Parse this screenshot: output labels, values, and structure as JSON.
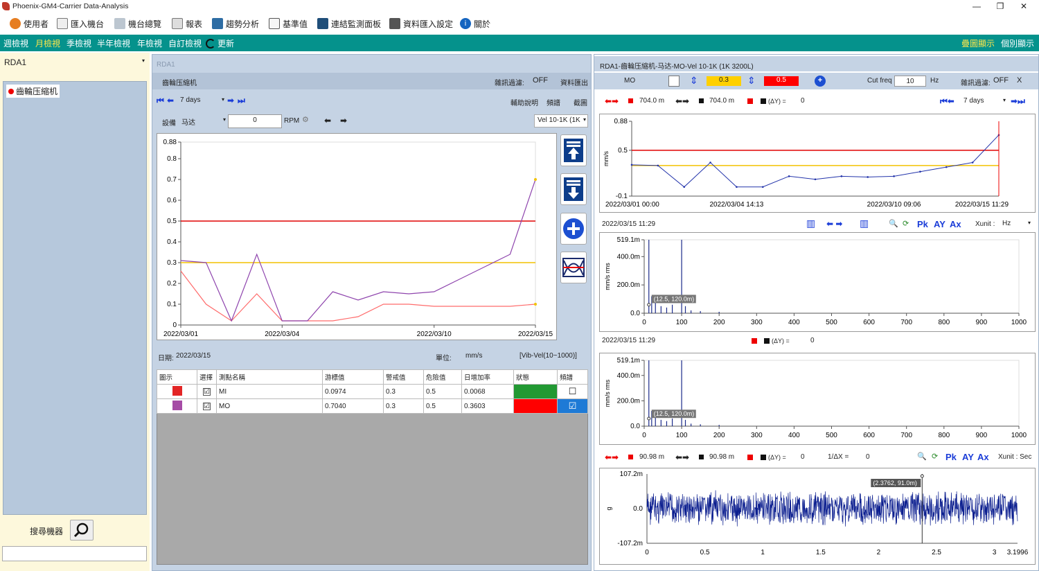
{
  "window": {
    "title": "Phoenix-GM4-Carrier Data-Analysis",
    "controls": [
      "—",
      "❐",
      "✕"
    ]
  },
  "menu": [
    {
      "label": "使用者",
      "color": "#e67e22"
    },
    {
      "label": "匯入機台",
      "color": "#7f8c8d"
    },
    {
      "label": "機台總覽",
      "color": "#2c3e50"
    },
    {
      "label": "報表",
      "color": "#95a5a6"
    },
    {
      "label": "趨勢分析",
      "color": "#2e6da4"
    },
    {
      "label": "基準值",
      "color": "#34495e"
    },
    {
      "label": "連結監測面板",
      "color": "#1f4e79"
    },
    {
      "label": "資料匯入設定",
      "color": "#555555"
    },
    {
      "label": "關於",
      "color": "#1565c0"
    }
  ],
  "views": {
    "items": [
      "週檢視",
      "月檢視",
      "季檢視",
      "半年檢視",
      "年檢視",
      "自訂檢視"
    ],
    "active": 1,
    "refresh": "更新",
    "overlay": "疊圖顯示",
    "individual": "個別顯示"
  },
  "left": {
    "selected": "RDA1",
    "tree_item": "齒輪压縮机",
    "search_label": "搜尋機器",
    "search_value": ""
  },
  "mid": {
    "title": "RDA1",
    "machine": "齒輪压縮机",
    "noise_filter_label": "雜訊過濾:",
    "noise_filter_value": "OFF",
    "export": "資料匯出",
    "period": "7 days",
    "help": "輔助說明",
    "spectrum": "頻譜",
    "screenshot": "截圖",
    "device_label": "設備",
    "device_value": "马达",
    "rpm_value": "0",
    "rpm_label": "RPM",
    "measure": "Vel 10-1K (1K",
    "date_label": "日期:",
    "date_value": "2022/03/15",
    "unit_label": "單位:",
    "unit_value": "mm/s",
    "range": "[Vib-Vel(10~1000)]",
    "table": {
      "headers": [
        "圖示",
        "選擇",
        "測點名稱",
        "游標值",
        "警戒值",
        "危險值",
        "日增加率",
        "狀態",
        "頻譜"
      ],
      "rows": [
        {
          "color": "#e32525",
          "checked": "☑",
          "name": "MI",
          "cursor": "0.0974",
          "warn": "0.3",
          "danger": "0.5",
          "rate": "0.0068",
          "status": "#229933",
          "spec": "☐"
        },
        {
          "color": "#a64ca6",
          "checked": "☑",
          "name": "MO",
          "cursor": "0.7040",
          "warn": "0.3",
          "danger": "0.5",
          "rate": "0.3603",
          "status": "#ff0000",
          "spec": "☑"
        }
      ]
    }
  },
  "right": {
    "title": "RDA1-齒輪压縮机-马达-MO-Vel 10-1K (1K 3200L)",
    "point": "MO",
    "warn": "0.3",
    "danger": "0.5",
    "cutfreq_label": "Cut freq",
    "cutfreq_value": "10",
    "hz": "Hz",
    "noise_label": "雜訊過濾:",
    "noise_value": "OFF",
    "close": "X",
    "cursor1": "704.0 m",
    "cursor2": "704.0 m",
    "delta_label": "(ΔY) =",
    "delta_value": "0",
    "period": "7 days",
    "spec_time1": "2022/03/15 11:29",
    "xunit_label": "Xunit :",
    "xunit_value": "Hz",
    "spec_time2": "2022/03/15 11:29",
    "delta2_value": "0",
    "wave_c1": "90.98 m",
    "wave_c2": "90.98 m",
    "delta3_value": "0",
    "inv_label": "1/ΔX =",
    "inv_value": "0",
    "xunit2": "Xunit : Sec",
    "tool_labels": [
      "Pk",
      "AY",
      "Ax"
    ],
    "spec_tooltip": "(12.5, 120.0m)",
    "wave_tooltip": "(2.3762, 91.0m)"
  },
  "chart_data": [
    {
      "type": "line",
      "title": "",
      "xlabel": "",
      "ylabel": "",
      "ylim": [
        0,
        0.88
      ],
      "yticks": [
        "0.88",
        "0.8",
        "0.7",
        "0.6",
        "0.5",
        "0.4",
        "0.3",
        "0.2",
        "0.1",
        "0"
      ],
      "xticklabels": [
        "2022/03/01",
        "2022/03/04",
        "2022/03/10",
        "2022/03/15"
      ],
      "x": [
        0,
        1,
        2,
        3,
        4,
        5,
        6,
        7,
        8,
        9,
        10,
        11,
        12,
        13,
        14
      ],
      "series": [
        {
          "name": "MI",
          "color": "#ff6b6b",
          "values": [
            0.26,
            0.1,
            0.02,
            0.15,
            0.02,
            0.02,
            0.02,
            0.04,
            0.1,
            0.1,
            0.09,
            0.09,
            0.09,
            0.09,
            0.1
          ]
        },
        {
          "name": "MO",
          "color": "#8e44ad",
          "values": [
            0.31,
            0.3,
            0.02,
            0.34,
            0.02,
            0.02,
            0.16,
            0.12,
            0.16,
            0.15,
            0.16,
            0.22,
            0.28,
            0.34,
            0.7
          ]
        }
      ],
      "thresholds": [
        {
          "value": 0.5,
          "color": "#e00000"
        },
        {
          "value": 0.3,
          "color": "#f2c200"
        }
      ]
    },
    {
      "type": "line",
      "title": "",
      "ylabel": "mm/s",
      "ylim": [
        -0.1,
        0.88
      ],
      "yticks": [
        "0.88",
        "0.5",
        "-0.1"
      ],
      "xticklabels": [
        "2022/03/01 00:00",
        "2022/03/04 14:13",
        "2022/03/10 09:06",
        "2022/03/15 11:29"
      ],
      "series": [
        {
          "name": "MO",
          "color": "#2233aa",
          "values": [
            0.31,
            0.3,
            0.02,
            0.34,
            0.02,
            0.02,
            0.16,
            0.12,
            0.16,
            0.15,
            0.16,
            0.22,
            0.28,
            0.34,
            0.7
          ]
        }
      ],
      "thresholds": [
        {
          "value": 0.5,
          "color": "#e00000"
        },
        {
          "value": 0.3,
          "color": "#f2c200"
        }
      ]
    },
    {
      "type": "bar",
      "ylabel": "mm/s rms",
      "ylim": [
        0,
        0.519
      ],
      "yticks": [
        "519.1m",
        "400.0m",
        "200.0m",
        "0.0"
      ],
      "xticks": [
        "0",
        "100",
        "200",
        "300",
        "400",
        "500",
        "600",
        "700",
        "800",
        "900",
        "1000"
      ],
      "xlim": [
        0,
        1000
      ],
      "peaks": [
        [
          12.5,
          0.519
        ],
        [
          20,
          0.12
        ],
        [
          30,
          0.08
        ],
        [
          45,
          0.05
        ],
        [
          60,
          0.04
        ],
        [
          75,
          0.06
        ],
        [
          100,
          0.519
        ],
        [
          110,
          0.05
        ],
        [
          125,
          0.02
        ],
        [
          150,
          0.015
        ],
        [
          200,
          0.01
        ]
      ]
    },
    {
      "type": "bar",
      "ylabel": "mm/s rms",
      "ylim": [
        0,
        0.519
      ],
      "yticks": [
        "519.1m",
        "400.0m",
        "200.0m",
        "0.0"
      ],
      "xticks": [
        "0",
        "100",
        "200",
        "300",
        "400",
        "500",
        "600",
        "700",
        "800",
        "900",
        "1000"
      ],
      "xlim": [
        0,
        1000
      ],
      "peaks": [
        [
          12.5,
          0.519
        ],
        [
          20,
          0.12
        ],
        [
          30,
          0.08
        ],
        [
          45,
          0.05
        ],
        [
          60,
          0.04
        ],
        [
          75,
          0.06
        ],
        [
          100,
          0.519
        ],
        [
          110,
          0.05
        ],
        [
          125,
          0.02
        ],
        [
          150,
          0.015
        ],
        [
          200,
          0.01
        ]
      ]
    },
    {
      "type": "line",
      "ylabel": "g",
      "ylim": [
        -0.1072,
        0.1072
      ],
      "yticks": [
        "107.2m",
        "0.0",
        "-107.2m"
      ],
      "xticks": [
        "0",
        "0.5",
        "1",
        "1.5",
        "2",
        "2.5",
        "3",
        "3.1996"
      ],
      "xlim": [
        0,
        3.1996
      ],
      "color": "#0b1e8f"
    }
  ]
}
